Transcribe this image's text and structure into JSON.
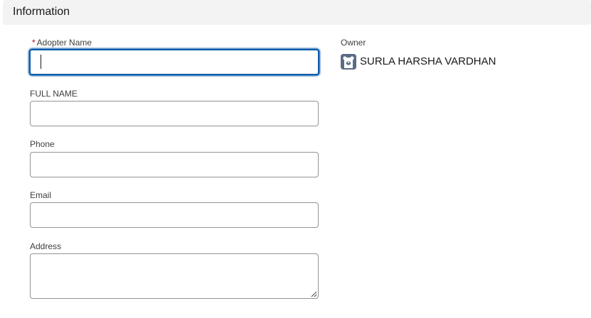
{
  "section": {
    "title": "Information"
  },
  "form": {
    "adopter_name": {
      "required_mark": "*",
      "label": "Adopter Name",
      "value": ""
    },
    "full_name": {
      "label": "FULL NAME",
      "value": ""
    },
    "phone": {
      "label": "Phone",
      "value": ""
    },
    "email": {
      "label": "Email",
      "value": ""
    },
    "address": {
      "label": "Address",
      "value": ""
    }
  },
  "owner": {
    "label": "Owner",
    "name": "SURLA HARSHA VARDHAN",
    "avatar_icon": "bear-avatar-icon"
  },
  "colors": {
    "focus_border": "#0b5cab",
    "required": "#ba0517",
    "header_bg": "#f3f3f3",
    "avatar_bg": "#5b6b85"
  }
}
